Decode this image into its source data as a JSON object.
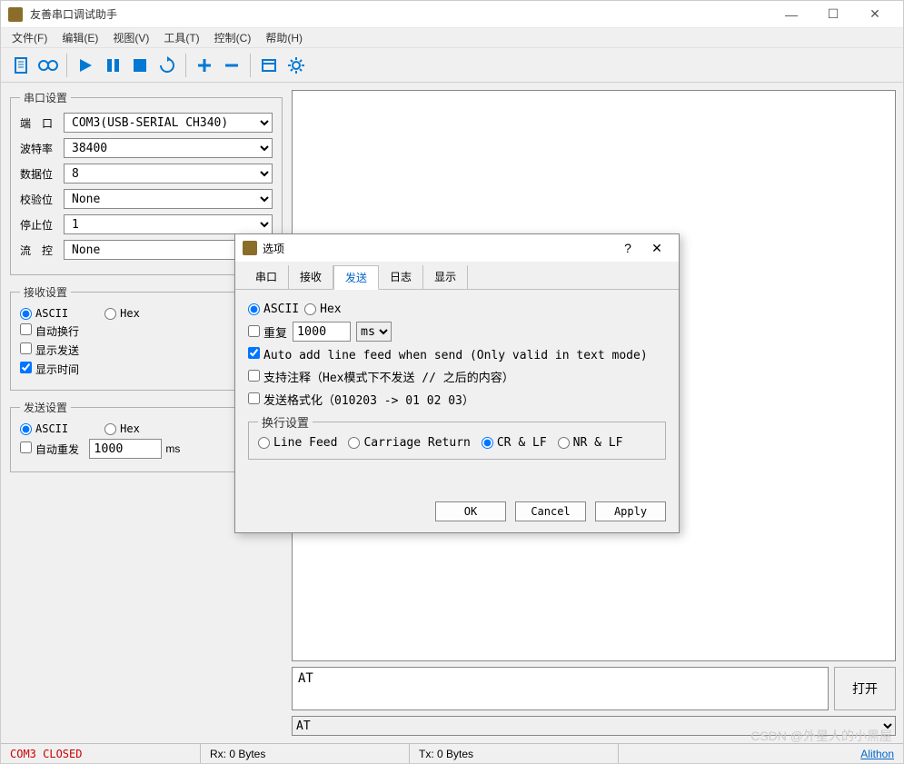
{
  "window": {
    "title": "友善串口调试助手",
    "controls": {
      "min": "—",
      "max": "☐",
      "close": "✕"
    }
  },
  "menu": {
    "file": "文件(F)",
    "edit": "编辑(E)",
    "view": "视图(V)",
    "tools": "工具(T)",
    "control": "控制(C)",
    "help": "帮助(H)"
  },
  "toolbar_icons": {
    "new": "new-doc-icon",
    "log": "log-icon",
    "play": "play-icon",
    "pause": "pause-icon",
    "stop": "stop-icon",
    "refresh": "refresh-icon",
    "plus": "plus-icon",
    "minus": "minus-icon",
    "window": "window-icon",
    "settings": "gear-icon"
  },
  "serial": {
    "legend": "串口设置",
    "port_label": "端　口",
    "port_value": "COM3(USB-SERIAL CH340)",
    "baud_label": "波特率",
    "baud_value": "38400",
    "data_label": "数据位",
    "data_value": "8",
    "parity_label": "校验位",
    "parity_value": "None",
    "stop_label": "停止位",
    "stop_value": "1",
    "flow_label": "流　控",
    "flow_value": "None"
  },
  "recv": {
    "legend": "接收设置",
    "ascii": "ASCII",
    "hex": "Hex",
    "auto_wrap": "自动换行",
    "show_send": "显示发送",
    "show_time": "显示时间"
  },
  "send": {
    "legend": "发送设置",
    "ascii": "ASCII",
    "hex": "Hex",
    "auto_repeat": "自动重发",
    "repeat_value": "1000",
    "repeat_unit": "ms"
  },
  "right": {
    "send_text": "AT",
    "open_btn": "打开",
    "history_value": "AT"
  },
  "dialog": {
    "title": "选项",
    "help": "?",
    "close": "✕",
    "tabs": {
      "serial": "串口",
      "recv": "接收",
      "send": "发送",
      "log": "日志",
      "display": "显示"
    },
    "ascii": "ASCII",
    "hex": "Hex",
    "repeat_label": "重复",
    "repeat_value": "1000",
    "repeat_unit": "ms",
    "auto_lf": "Auto add line feed when send (Only valid in text mode)",
    "comment": "支持注释（Hex模式下不发送 // 之后的内容）",
    "format": "发送格式化（010203 -> 01 02 03）",
    "lf_legend": "换行设置",
    "lf_opts": {
      "lf": "Line Feed",
      "cr": "Carriage Return",
      "crlf": "CR & LF",
      "nrlf": "NR & LF"
    },
    "btns": {
      "ok": "OK",
      "cancel": "Cancel",
      "apply": "Apply"
    }
  },
  "status": {
    "com": "COM3 CLOSED",
    "rx": "Rx: 0 Bytes",
    "tx": "Tx: 0 Bytes",
    "link": "Alithon"
  },
  "watermark": "CSDN @外星人的小黑屋"
}
